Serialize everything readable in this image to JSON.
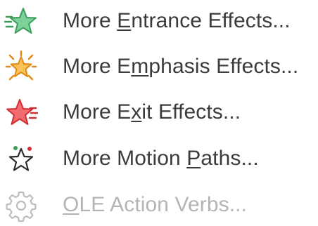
{
  "menu": {
    "items": [
      {
        "icon": "entrance-effect-star-icon",
        "pre": "More ",
        "key": "E",
        "post": "ntrance Effects...",
        "enabled": true,
        "color": "#4fb26a"
      },
      {
        "icon": "emphasis-effect-star-icon",
        "pre": "More E",
        "key": "m",
        "post": "phasis Effects...",
        "enabled": true,
        "color": "#f5b13c"
      },
      {
        "icon": "exit-effect-star-icon",
        "pre": "More E",
        "key": "x",
        "post": "it Effects...",
        "enabled": true,
        "color": "#e8464a"
      },
      {
        "icon": "motion-path-star-icon",
        "pre": "More Motion ",
        "key": "P",
        "post": "aths...",
        "enabled": true,
        "color": "#3b3b3b"
      },
      {
        "icon": "gear-icon",
        "pre": "",
        "key": "O",
        "post": "LE Action Verbs...",
        "enabled": false,
        "color": "#bdbdbd"
      }
    ]
  }
}
